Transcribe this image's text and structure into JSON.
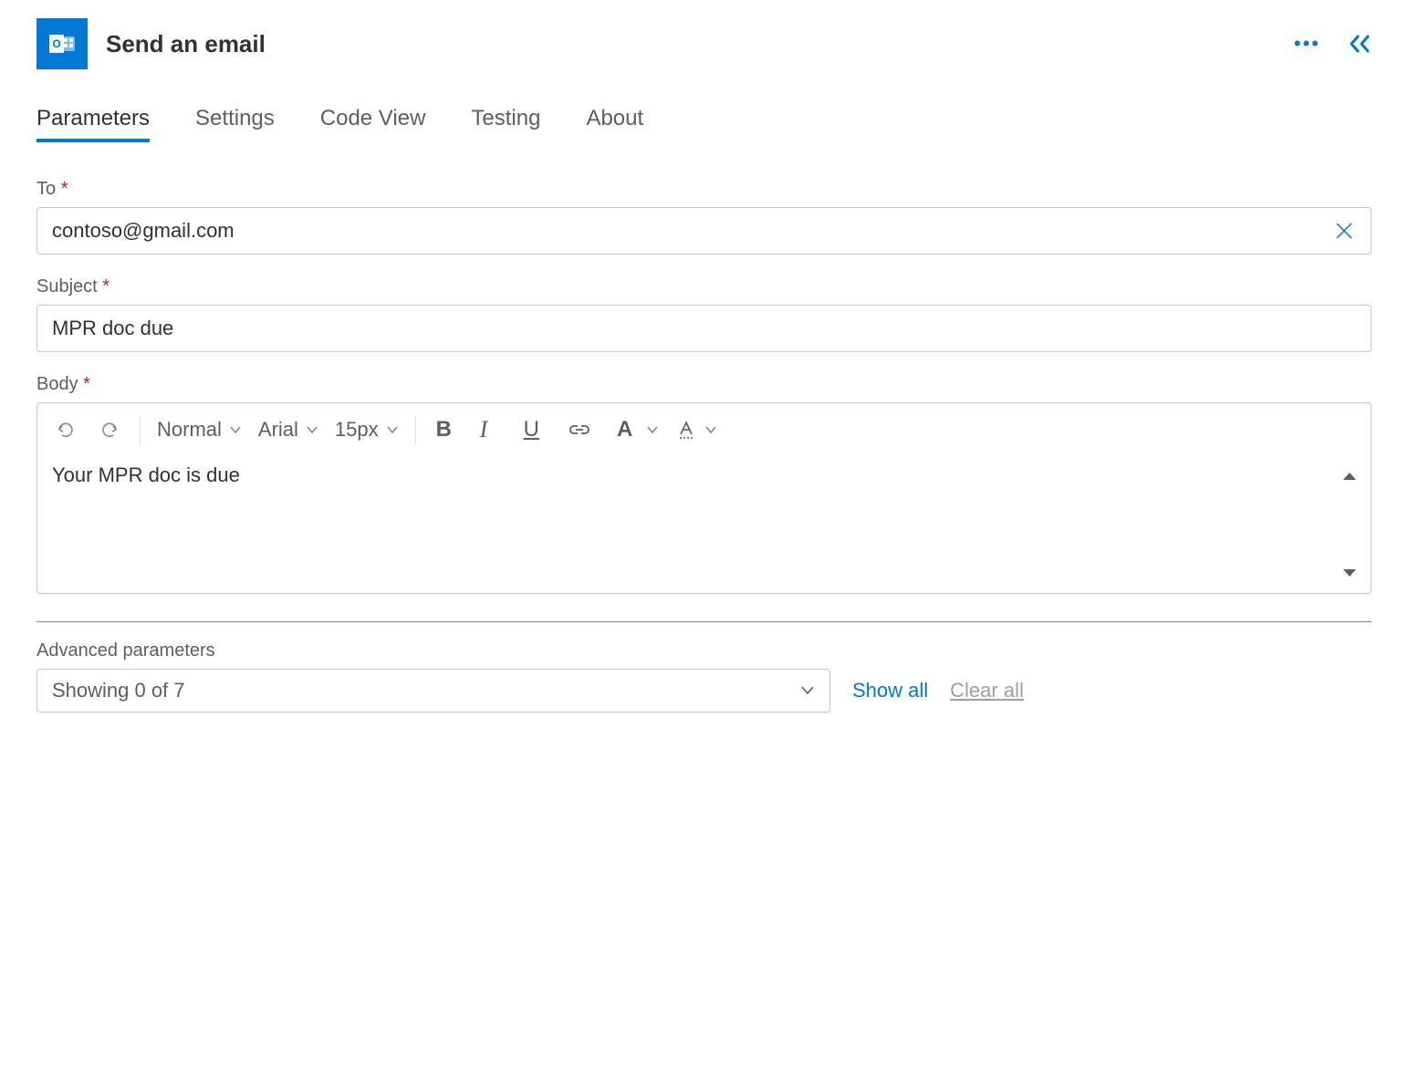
{
  "header": {
    "title": "Send an email"
  },
  "tabs": [
    {
      "label": "Parameters",
      "active": true
    },
    {
      "label": "Settings",
      "active": false
    },
    {
      "label": "Code View",
      "active": false
    },
    {
      "label": "Testing",
      "active": false
    },
    {
      "label": "About",
      "active": false
    }
  ],
  "fields": {
    "to": {
      "label": "To",
      "required": "*",
      "value": "contoso@gmail.com"
    },
    "subject": {
      "label": "Subject",
      "required": "*",
      "value": "MPR doc due"
    },
    "body": {
      "label": "Body",
      "required": "*",
      "content": "Your MPR doc is due"
    }
  },
  "editor": {
    "style": "Normal",
    "font": "Arial",
    "size": "15px",
    "bold": "B",
    "italic": "I",
    "underline": "U",
    "fontcolor": "A"
  },
  "advanced": {
    "label": "Advanced parameters",
    "showing": "Showing 0 of 7",
    "showAll": "Show all",
    "clearAll": "Clear all"
  }
}
